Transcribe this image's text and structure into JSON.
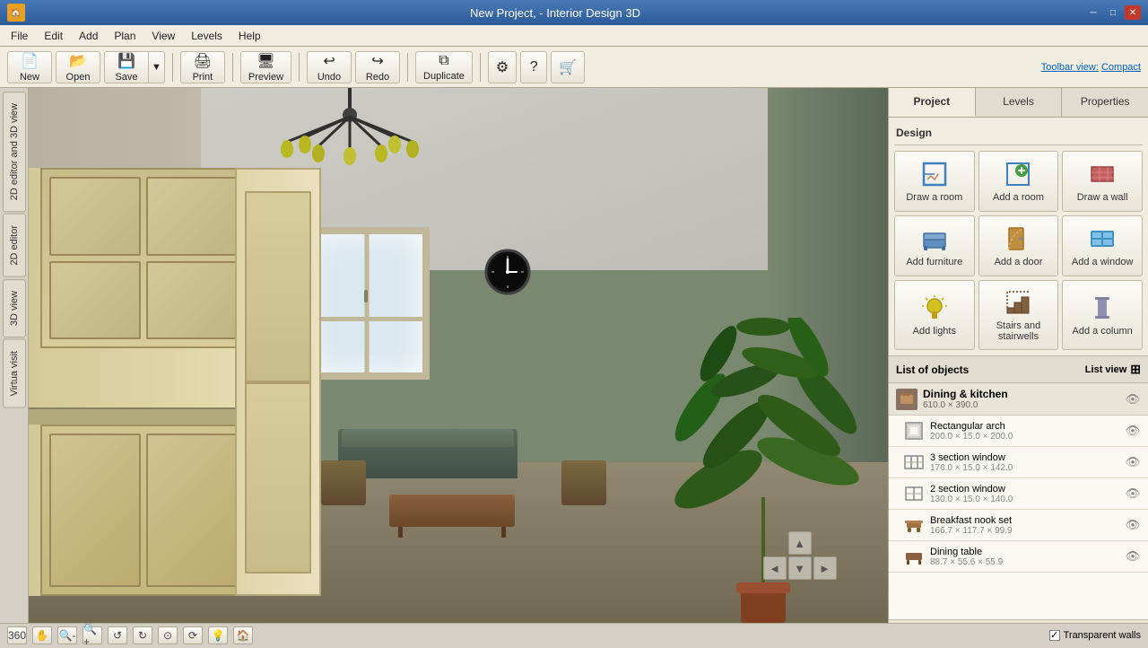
{
  "window": {
    "title": "New Project, - Interior Design 3D",
    "app_icon": "🏠"
  },
  "menubar": {
    "items": [
      "File",
      "Edit",
      "Add",
      "Plan",
      "View",
      "Levels",
      "Help"
    ]
  },
  "toolbar": {
    "new_label": "New",
    "open_label": "Open",
    "save_label": "Save",
    "print_label": "Print",
    "preview_label": "Preview",
    "undo_label": "Undo",
    "redo_label": "Redo",
    "duplicate_label": "Duplicate",
    "settings_label": "⚙",
    "help_label": "?",
    "store_label": "🛒",
    "toolbar_view_label": "Toolbar view:",
    "compact_label": "Compact"
  },
  "left_sidebar": {
    "tabs": [
      "2D editor and 3D view",
      "2D editor",
      "3D view",
      "Virtua visit"
    ]
  },
  "right_panel": {
    "tabs": [
      "Project",
      "Levels",
      "Properties"
    ],
    "active_tab": "Project",
    "design_section_title": "Design",
    "design_buttons": [
      {
        "label": "Draw a room",
        "icon": "room"
      },
      {
        "label": "Add a room",
        "icon": "addroom"
      },
      {
        "label": "Draw a wall",
        "icon": "wall"
      },
      {
        "label": "Add furniture",
        "icon": "furniture"
      },
      {
        "label": "Add a door",
        "icon": "door"
      },
      {
        "label": "Add a window",
        "icon": "window"
      },
      {
        "label": "Add lights",
        "icon": "lights"
      },
      {
        "label": "Stairs and stairwells",
        "icon": "stairs"
      },
      {
        "label": "Add a column",
        "icon": "column"
      }
    ],
    "objects_header": "List of objects",
    "list_view_label": "List view",
    "objects": [
      {
        "type": "category",
        "name": "Dining & kitchen",
        "dims": "610.0 × 390.0"
      },
      {
        "type": "item",
        "name": "Rectangular arch",
        "dims": "200.0 × 15.0 × 200.0"
      },
      {
        "type": "item",
        "name": "3 section window",
        "dims": "176.0 × 15.0 × 142.0"
      },
      {
        "type": "item",
        "name": "2 section window",
        "dims": "130.0 × 15.0 × 140.0"
      },
      {
        "type": "item",
        "name": "Breakfast nook set",
        "dims": "166.7 × 117.7 × 99.9"
      },
      {
        "type": "item",
        "name": "Dining table",
        "dims": "88.7 × 55.6 × 55.9"
      }
    ]
  },
  "bottom_toolbar": {
    "transparent_walls_label": "Transparent walls",
    "transparent_walls_checked": true
  }
}
